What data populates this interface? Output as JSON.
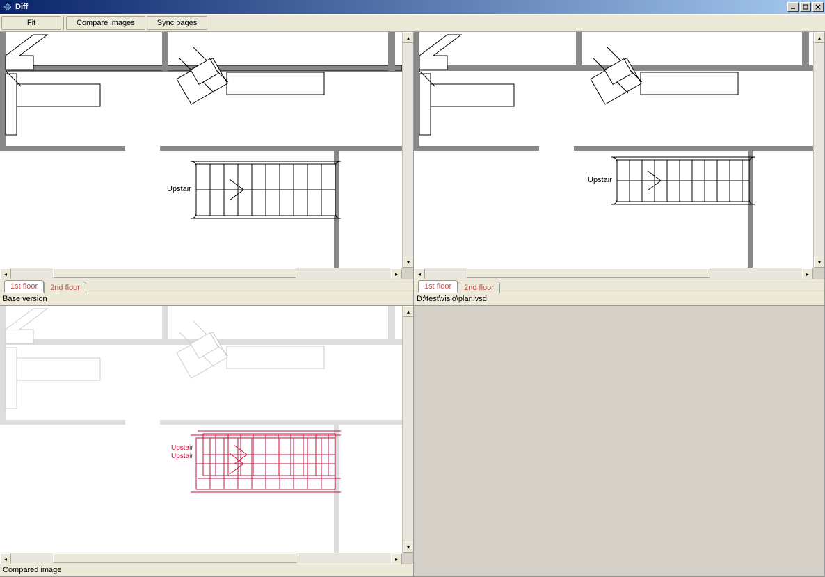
{
  "window": {
    "title": "Diff"
  },
  "toolbar": {
    "fit": "Fit",
    "compare": "Compare images",
    "sync": "Sync pages"
  },
  "tabs": {
    "t1": "1st floor",
    "t2": "2nd floor"
  },
  "panes": {
    "tl_status": "Base version",
    "tr_status": "D:\\test\\visio\\plan.vsd",
    "bl_status": "Compared image"
  },
  "floorplan": {
    "upstair_label": "Upstair",
    "upstair_label2": "Upstair"
  }
}
